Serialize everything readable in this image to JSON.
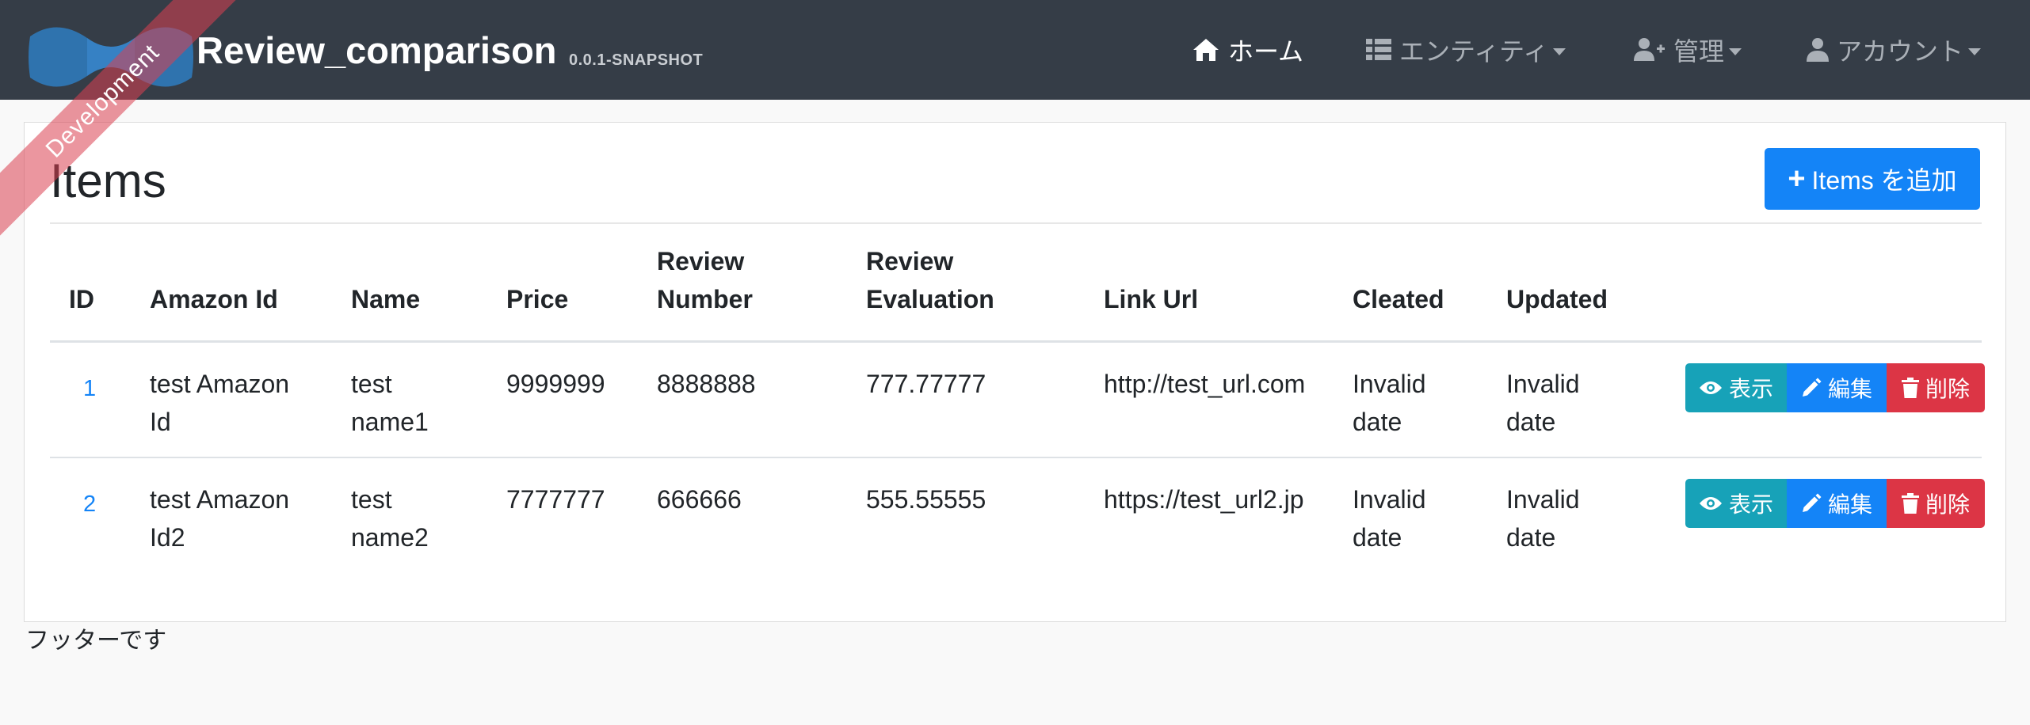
{
  "navbar": {
    "ribbon_label": "Development",
    "brand_title": "Review_comparison",
    "brand_version": "0.0.1-SNAPSHOT",
    "items": [
      {
        "label": "ホーム",
        "icon": "home-icon",
        "dropdown": false,
        "active": true
      },
      {
        "label": "エンティティ",
        "icon": "list-icon",
        "dropdown": true,
        "active": false
      },
      {
        "label": "管理",
        "icon": "user-plus-icon",
        "dropdown": true,
        "active": false
      },
      {
        "label": "アカウント",
        "icon": "user-icon",
        "dropdown": true,
        "active": false
      }
    ]
  },
  "page": {
    "title": "Items",
    "add_button_label": "Items を追加"
  },
  "table": {
    "headers": {
      "id": "ID",
      "amazon_id": "Amazon Id",
      "name": "Name",
      "price": "Price",
      "review_number": [
        "Review",
        "Number"
      ],
      "review_evaluation": [
        "Review",
        "Evaluation"
      ],
      "link_url": "Link Url",
      "cleated": "Cleated",
      "updated": "Updated"
    },
    "rows": [
      {
        "id": "1",
        "amazon_id": [
          "test Amazon",
          "Id"
        ],
        "name": [
          "test",
          "name1"
        ],
        "price": "9999999",
        "review_number": "8888888",
        "review_evaluation": "777.77777",
        "link_url": "http://test_url.com",
        "cleated": [
          "Invalid",
          "date"
        ],
        "updated": [
          "Invalid",
          "date"
        ]
      },
      {
        "id": "2",
        "amazon_id": [
          "test Amazon",
          "Id2"
        ],
        "name": [
          "test",
          "name2"
        ],
        "price": "7777777",
        "review_number": "666666",
        "review_evaluation": "555.55555",
        "link_url": "https://test_url2.jp",
        "cleated": [
          "Invalid",
          "date"
        ],
        "updated": [
          "Invalid",
          "date"
        ]
      }
    ],
    "actions": {
      "view": "表示",
      "edit": "編集",
      "delete": "削除"
    }
  },
  "footer": {
    "text": "フッターです"
  },
  "colors": {
    "navbar_bg": "#353d47",
    "primary": "#1484f7",
    "info": "#17a2b8",
    "danger": "#dc3545",
    "ribbon": "#da4050"
  }
}
